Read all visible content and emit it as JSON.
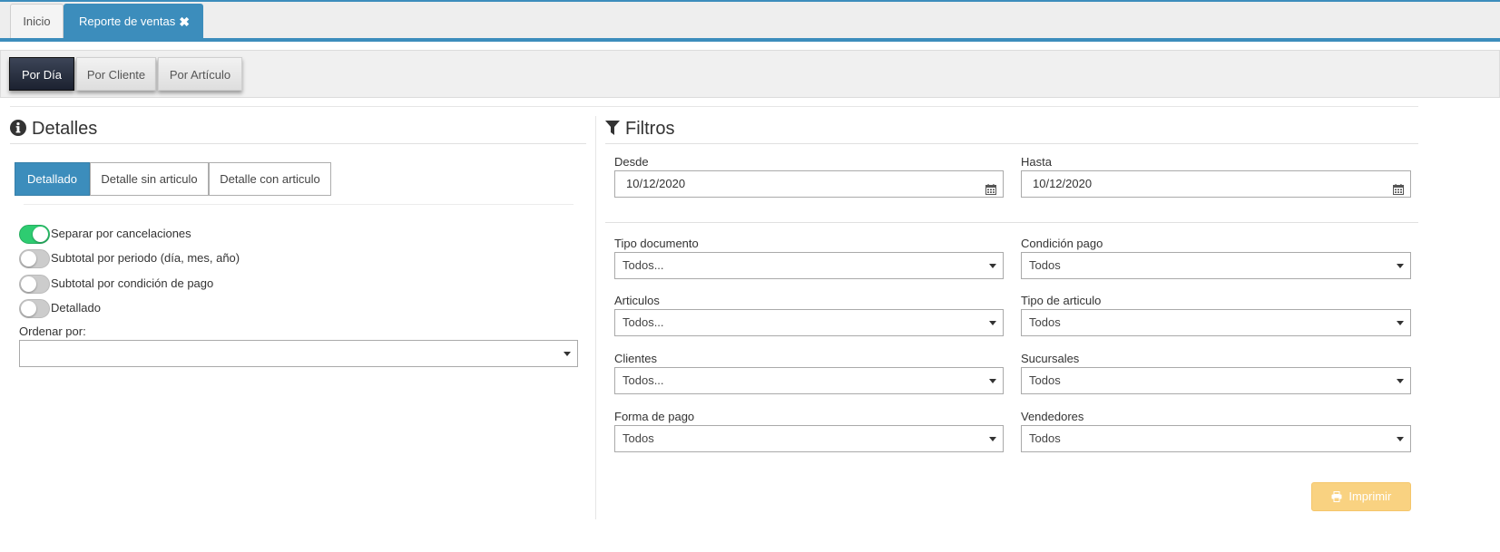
{
  "top_tabs": {
    "inicio": "Inicio",
    "reporte": "Reporte de ventas",
    "close_glyph": "✖"
  },
  "report_tabs": [
    "Por Día",
    "Por Cliente",
    "Por Artículo"
  ],
  "detalles": {
    "title": "Detalles",
    "view_buttons": [
      "Detallado",
      "Detalle sin articulo",
      "Detalle con articulo"
    ],
    "toggles": [
      {
        "label": "Separar por cancelaciones",
        "on": true
      },
      {
        "label": "Subtotal por periodo (día, mes, año)",
        "on": false
      },
      {
        "label": "Subtotal por condición de pago",
        "on": false
      },
      {
        "label": "Detallado",
        "on": false
      }
    ],
    "order_label": "Ordenar por:",
    "order_value": ""
  },
  "filtros": {
    "title": "Filtros",
    "desde_label": "Desde",
    "desde_value": "10/12/2020",
    "hasta_label": "Hasta",
    "hasta_value": "10/12/2020",
    "tipo_documento": {
      "label": "Tipo documento",
      "value": "Todos..."
    },
    "condicion_pago": {
      "label": "Condición pago",
      "value": "Todos"
    },
    "articulos": {
      "label": "Articulos",
      "value": "Todos..."
    },
    "tipo_articulo": {
      "label": "Tipo de articulo",
      "value": "Todos"
    },
    "clientes": {
      "label": "Clientes",
      "value": "Todos..."
    },
    "sucursales": {
      "label": "Sucursales",
      "value": "Todos"
    },
    "forma_pago": {
      "label": "Forma de pago",
      "value": "Todos"
    },
    "vendedores": {
      "label": "Vendedores",
      "value": "Todos"
    }
  },
  "print_button": "Imprimir",
  "colors": {
    "accent": "#3c8dbc",
    "toggle_on": "#2ecc71",
    "print": "#f9d281"
  }
}
